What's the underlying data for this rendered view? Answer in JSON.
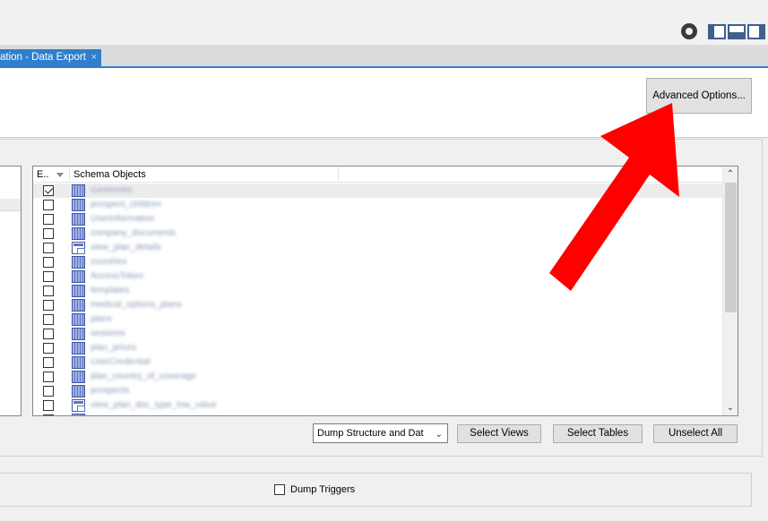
{
  "tab": {
    "label": "ation - Data Export",
    "close": "×"
  },
  "header": {
    "advanced_options": "Advanced Options..."
  },
  "list": {
    "col_checkbox": "E..",
    "col_name": "Schema Objects",
    "rows": [
      {
        "name": "currencies",
        "type": "table",
        "checked": true
      },
      {
        "name": "prospect_children",
        "type": "table",
        "checked": false
      },
      {
        "name": "UserInformation",
        "type": "table",
        "checked": false
      },
      {
        "name": "company_documents",
        "type": "table",
        "checked": false
      },
      {
        "name": "view_plan_details",
        "type": "view",
        "checked": false
      },
      {
        "name": "countries",
        "type": "table",
        "checked": false
      },
      {
        "name": "AccessToken",
        "type": "table",
        "checked": false
      },
      {
        "name": "templates",
        "type": "table",
        "checked": false
      },
      {
        "name": "medical_options_plans",
        "type": "table",
        "checked": false
      },
      {
        "name": "plans",
        "type": "table",
        "checked": false
      },
      {
        "name": "sessions",
        "type": "table",
        "checked": false
      },
      {
        "name": "plan_prices",
        "type": "table",
        "checked": false
      },
      {
        "name": "UserCredential",
        "type": "table",
        "checked": false
      },
      {
        "name": "plan_country_of_coverage",
        "type": "table",
        "checked": false
      },
      {
        "name": "prospects",
        "type": "table",
        "checked": false
      },
      {
        "name": "view_plan_doc_type_low_value",
        "type": "view",
        "checked": false
      },
      {
        "name": "",
        "type": "table",
        "checked": false
      }
    ]
  },
  "controls": {
    "dump_select": "Dump Structure and Dat",
    "select_views": "Select Views",
    "select_tables": "Select Tables",
    "unselect_all": "Unselect All"
  },
  "triggers": {
    "label": "Dump Triggers",
    "checked": false
  },
  "colors": {
    "accent": "#2f7fcc",
    "arrow": "#ff0000"
  },
  "icons": {
    "settings": "gear-icon",
    "layout_left": "sidebar-left-icon",
    "layout_bottom": "panel-bottom-icon",
    "layout_right": "sidebar-right-icon",
    "table": "table-icon",
    "view": "view-icon"
  }
}
